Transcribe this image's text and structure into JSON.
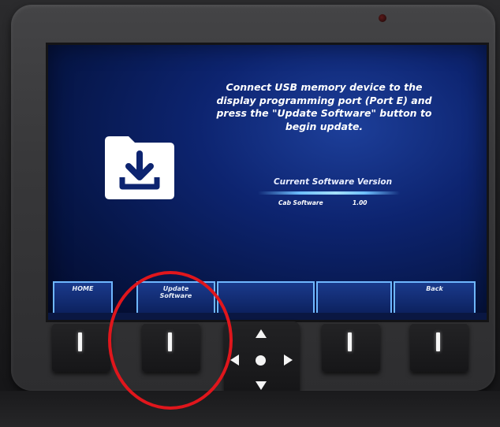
{
  "screen": {
    "message": "Connect USB memory device to the display programming port (Port E) and press the \"Update Software\" button to begin update.",
    "version_heading": "Current Software Version",
    "version_item_name": "Cab Software",
    "version_item_value": "1.00",
    "icon": "folder-download-icon"
  },
  "softkeys": {
    "home": "HOME",
    "update_line1": "Update",
    "update_line2": "Software",
    "back": "Back"
  },
  "colors": {
    "screen_background": "#0d2470",
    "softkey_border": "#6fb7ff",
    "highlight_circle": "#e0161c"
  },
  "hardware": {
    "buttons": [
      "softkey-button-1",
      "softkey-button-2",
      "softkey-button-4",
      "softkey-button-5"
    ],
    "dpad_icons": [
      "arrow-up-icon",
      "arrow-down-icon",
      "arrow-left-icon",
      "arrow-right-icon",
      "select-center-icon"
    ]
  }
}
